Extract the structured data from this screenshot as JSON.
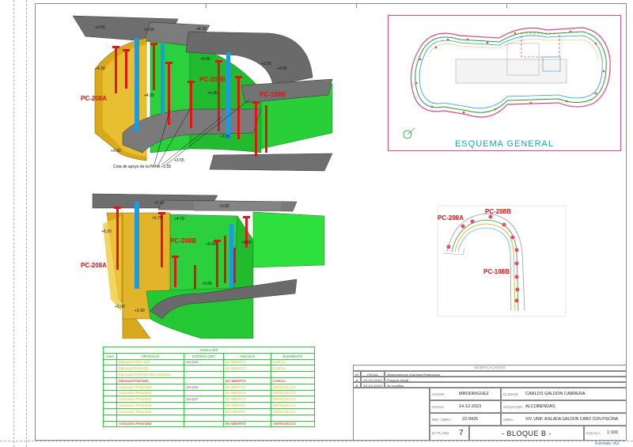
{
  "views": {
    "top": {
      "labels": {
        "pc208a": "PC-208A",
        "pc208b": "PC-208B",
        "pc108b": "PC-108B"
      },
      "levels": [
        "+3.55",
        "+4.30",
        "+4.70",
        "+3.55",
        "+5.60",
        "+3.55",
        "+4.30",
        "+4.30",
        "+3.55",
        "+2.90",
        "+3.55",
        "+3.55"
      ],
      "note": "Cota de apoyo de la PAHA +3.55"
    },
    "bottom": {
      "labels": {
        "pc208a": "PC-208A",
        "pc208b": "PC-208B"
      },
      "levels": [
        "+7.20",
        "+3.55",
        "+6.70",
        "+4.70",
        "+6.20",
        "+5.60",
        "+6.60",
        "+3.55",
        "+2.90",
        "+2.90"
      ]
    }
  },
  "schema": {
    "title": "ESQUEMA GENERAL"
  },
  "plan_detail": {
    "labels": {
      "pc208a": "PC-208A",
      "pc208b": "PC-208B",
      "pc108b": "PC-108B"
    }
  },
  "anclajes": {
    "title": "ANCLAJES",
    "headers": [
      "Cant",
      "ARTICULO",
      "CODIGO ODC",
      "ANGULO",
      "ELEMENTO"
    ],
    "rows": [
      {
        "c1": "",
        "c2": "Ménsula PAHA-300",
        "c3": "VH-213",
        "c4": "60 ABIERTO",
        "c5": "CARGA",
        "color": "c-y"
      },
      {
        "c1": "",
        "c2": "Ménsula PAHA300",
        "c3": "",
        "c4": "40 ABIERTO",
        "c5": "CARGA",
        "color": "c-y"
      },
      {
        "c1": "",
        "c2": "Ménsula PAHA300 RECORTADA",
        "c3": "",
        "c4": "",
        "c5": "",
        "color": "c-y"
      },
      {
        "c1": "",
        "c2": "Ménsula PAHA300",
        "c3": "",
        "c4": "60 ABIERTO",
        "c5": "CARGA",
        "color": "c-r"
      },
      {
        "c1": "",
        "c2": "Antivuelco PAHA300",
        "c3": "VH-205",
        "c4": "60 ABIERTO",
        "c5": "ANTIVUELCO",
        "color": "c-y"
      },
      {
        "c1": "",
        "c2": "Antivuelco PAHA300",
        "c3": "",
        "c4": "40 ABIERTO",
        "c5": "ANTIVUELCO",
        "color": "c-y"
      },
      {
        "c1": "",
        "c2": "Antivuelco PAHA300",
        "c3": "VH-207",
        "c4": "60 ABIERTO",
        "c5": "ANTIVUELCO",
        "color": "c-y"
      },
      {
        "c1": "",
        "c2": "Antivuelco PAHA300",
        "c3": "",
        "c4": "40 ABIERTO",
        "c5": "ANTIVUELCO",
        "color": "c-y"
      },
      {
        "c1": "",
        "c2": "Antivuelco PAHA300",
        "c3": "",
        "c4": "40 ABIERTO",
        "c5": "ANTIVUELCO",
        "color": "c-y"
      },
      {
        "c1": "",
        "c2": "",
        "c3": "",
        "c4": "",
        "c5": "",
        "color": "c-y"
      },
      {
        "c1": "",
        "c2": "Antivuelco PAHA300",
        "c3": "",
        "c4": "60 ABIERTO",
        "c5": "ANTIVUELCO",
        "color": "c-r"
      }
    ]
  },
  "title_block": {
    "modificaciones": {
      "title": "MODIFICACIONES",
      "headers": [
        "Nº",
        "FECHA",
        "Observaciones (Cambios Realizados)"
      ],
      "rows": [
        {
          "n": "A",
          "fecha": "XX-XX-XXXX",
          "obs": "Proyecto Inicial"
        },
        {
          "n": "B",
          "fecha": "XX-XX-XXXX",
          "obs": "Se modifica"
        }
      ]
    },
    "autor_label": "AUTOR",
    "autor": "MRODRIGUEZ",
    "fecha_label": "FECHA",
    "fecha": "14-12-2023",
    "ref_label": "REF. OBRA",
    "ref": "22-0426",
    "cliente_label": "CLIENTE",
    "cliente": "CARLOS GALDON CABRERA",
    "situacion_label": "SITUACION",
    "situacion": "ALCOBENDAS",
    "obra_label": "OBRA",
    "obra": "VIV. UNIF. AISLADA GALDON CARO CON PISCINA",
    "plano_label": "Nº PLANO",
    "plano": "7",
    "bloque": "- BLOQUE B -",
    "escala_label": "ESCALA",
    "escala": "1:100",
    "formato": "Formato: A3"
  }
}
